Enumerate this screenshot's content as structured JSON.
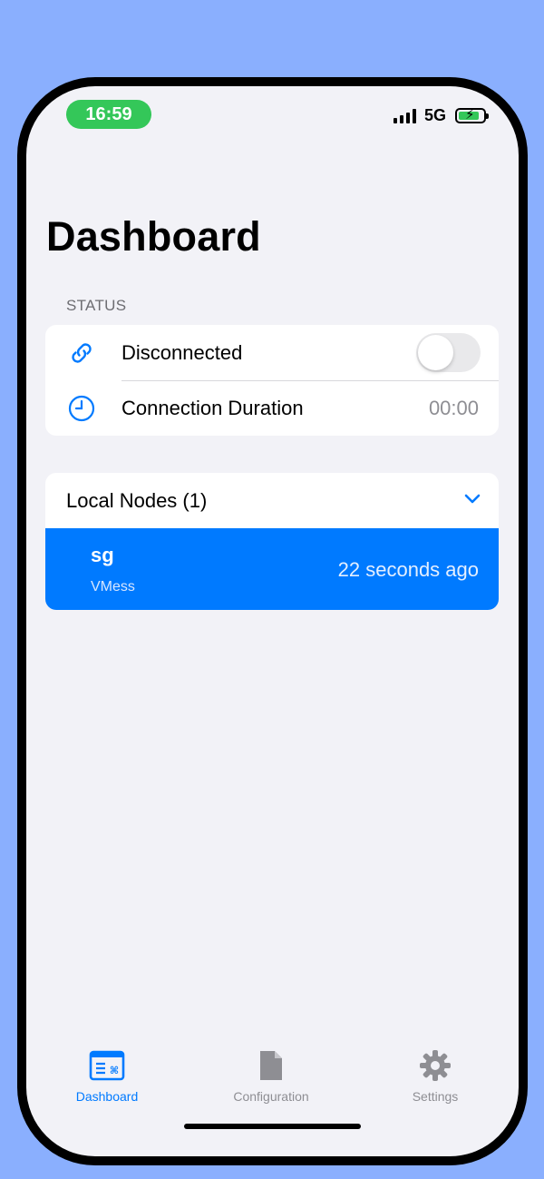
{
  "status_bar": {
    "time": "16:59",
    "network": "5G"
  },
  "page_title": "Dashboard",
  "status_section": {
    "header": "STATUS",
    "connection_label": "Disconnected",
    "toggle_on": false,
    "duration_label": "Connection Duration",
    "duration_value": "00:00"
  },
  "nodes": {
    "header": "Local Nodes (1)",
    "items": [
      {
        "name": "sg",
        "protocol": "VMess",
        "updated": "22 seconds ago"
      }
    ]
  },
  "tabbar": {
    "tabs": [
      {
        "label": "Dashboard",
        "active": true
      },
      {
        "label": "Configuration",
        "active": false
      },
      {
        "label": "Settings",
        "active": false
      }
    ]
  },
  "colors": {
    "background": "#8aaffe",
    "accent": "#007aff",
    "time_pill": "#34c759",
    "inactive_tab": "#8e8e93"
  }
}
